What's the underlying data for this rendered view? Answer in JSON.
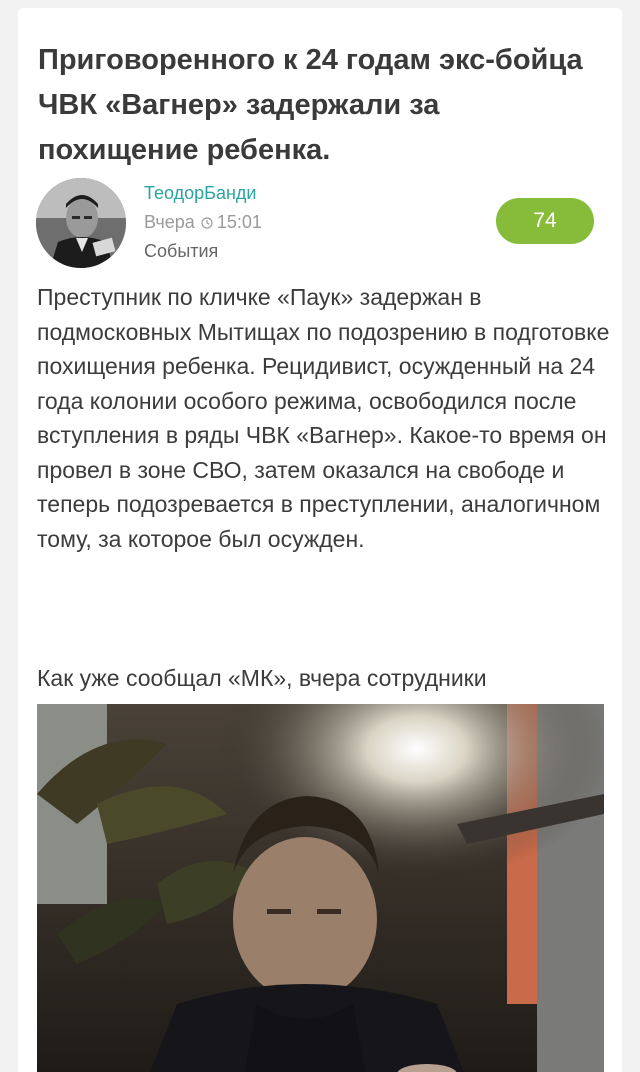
{
  "article": {
    "title": "Приговоренного к 24 годам экс-бойца ЧВК «Вагнер» задержали за похищение ребенка.",
    "author": "ТеодорБанди",
    "date_label": "Вчера",
    "time": "15:01",
    "category": "События",
    "rating": "74",
    "paragraph_1": "Преступник по кличке «Паук» задержан в подмосковных Мытищах по подозрению в подготовке похищения ребенка. Рецидивист, осужденный на 24 года колонии особого режима, освободился после вступления в ряды ЧВК «Вагнер». Какое-то время он провел в зоне СВО, затем оказался на свободе и теперь подозревается в преступлении, аналогичном тому, за которое был осужден.",
    "paragraph_2": "Как уже сообщал «МК», вчера сотрудники"
  },
  "colors": {
    "author": "#2aa3a3",
    "rating_bg": "#86bc3a",
    "title": "#3a3a3a",
    "meta": "#9a9a9a"
  },
  "icons": {
    "time": "clock-icon"
  }
}
